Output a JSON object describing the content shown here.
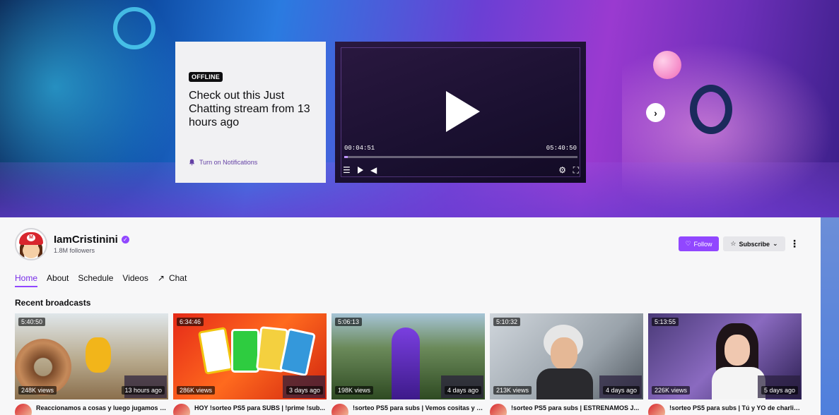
{
  "banner": {
    "offline_badge": "OFFLINE",
    "offline_text": "Check out this Just Chatting stream from 13 hours ago",
    "notifications_label": "Turn on Notifications",
    "player": {
      "current_time": "00:04:51",
      "duration": "05:40:50",
      "progress": 0.014
    }
  },
  "channel": {
    "name": "IamCristinini",
    "followers": "1.8M followers",
    "follow_label": "Follow",
    "subscribe_label": "Subscribe"
  },
  "tabs": [
    {
      "label": "Home",
      "active": true
    },
    {
      "label": "About"
    },
    {
      "label": "Schedule"
    },
    {
      "label": "Videos"
    },
    {
      "label": "Chat"
    }
  ],
  "section_title": "Recent broadcasts",
  "broadcasts": [
    {
      "duration": "5:40:50",
      "views": "248K views",
      "age": "13 hours ago",
      "title": "Reaccionamos a cosas y luego jugamos co..."
    },
    {
      "duration": "6:34:46",
      "views": "286K views",
      "age": "3 days ago",
      "title": "HOY !sorteo PS5 para SUBS | !prime !sub..."
    },
    {
      "duration": "5:06:13",
      "views": "198K views",
      "age": "4 days ago",
      "title": "!sorteo PS5 para subs | Vemos cositas y l..."
    },
    {
      "duration": "5:10:32",
      "views": "213K views",
      "age": "4 days ago",
      "title": "!sorteo PS5 para subs | ESTRENAMOS J..."
    },
    {
      "duration": "5:13:55",
      "views": "226K views",
      "age": "5 days ago",
      "title": "!sorteo PS5 para subs | Tú y YO de charlit..."
    }
  ],
  "colors": {
    "accent": "#9147ff",
    "accent_text": "#772ce8"
  }
}
